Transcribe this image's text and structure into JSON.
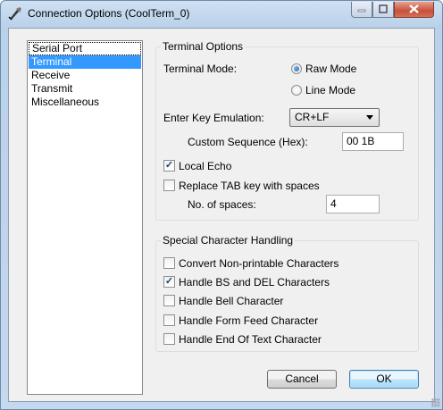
{
  "window": {
    "title": "Connection Options (CoolTerm_0)"
  },
  "sidebar": {
    "items": [
      {
        "label": "Serial Port"
      },
      {
        "label": "Terminal"
      },
      {
        "label": "Receive"
      },
      {
        "label": "Transmit"
      },
      {
        "label": "Miscellaneous"
      }
    ]
  },
  "terminal_options": {
    "title": "Terminal Options",
    "mode_label": "Terminal Mode:",
    "raw_mode": "Raw Mode",
    "line_mode": "Line Mode",
    "enter_key_label": "Enter Key Emulation:",
    "enter_key_value": "CR+LF",
    "custom_seq_label": "Custom Sequence (Hex):",
    "custom_seq_value": "00 1B",
    "local_echo": "Local Echo",
    "replace_tab": "Replace TAB key with spaces",
    "spaces_label": "No. of spaces:",
    "spaces_value": "4"
  },
  "special_chars": {
    "title": "Special Character Handling",
    "convert_nonprintable": "Convert Non-printable Characters",
    "handle_bs_del": "Handle BS and DEL Characters",
    "handle_bell": "Handle Bell Character",
    "handle_form_feed": "Handle Form Feed Character",
    "handle_end_text": "Handle End Of Text Character"
  },
  "buttons": {
    "cancel": "Cancel",
    "ok": "OK"
  }
}
